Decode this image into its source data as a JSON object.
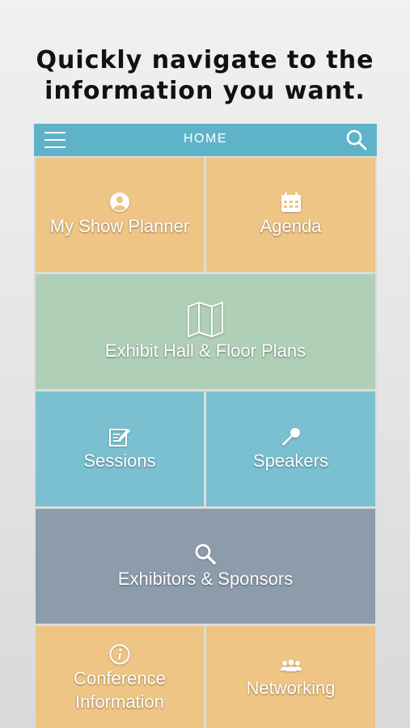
{
  "headline": {
    "line1": "Quickly navigate to the",
    "line2": "information you want."
  },
  "navbar": {
    "title": "HOME",
    "menu_icon": "hamburger-menu-icon",
    "search_icon": "search-icon"
  },
  "tiles": [
    {
      "label": "My Show Planner",
      "icon": "user-icon",
      "color": "#eec584"
    },
    {
      "label": "Agenda",
      "icon": "calendar-icon",
      "color": "#eec584"
    },
    {
      "label": "Exhibit Hall & Floor Plans",
      "icon": "map-icon",
      "color": "#afcfb7"
    },
    {
      "label": "Sessions",
      "icon": "edit-icon",
      "color": "#7bc0d1"
    },
    {
      "label": "Speakers",
      "icon": "microphone-icon",
      "color": "#7bc0d1"
    },
    {
      "label": "Exhibitors & Sponsors",
      "icon": "search-icon",
      "color": "#8d9cab"
    },
    {
      "label_line1": "Conference",
      "label_line2": "Information",
      "icon": "info-icon",
      "color": "#eec584"
    },
    {
      "label": "Networking",
      "icon": "people-icon",
      "color": "#eec584"
    }
  ],
  "colors": {
    "navbar": "#5fb3c9",
    "background": "#e6e6e6",
    "divider": "#dcdcdc"
  }
}
